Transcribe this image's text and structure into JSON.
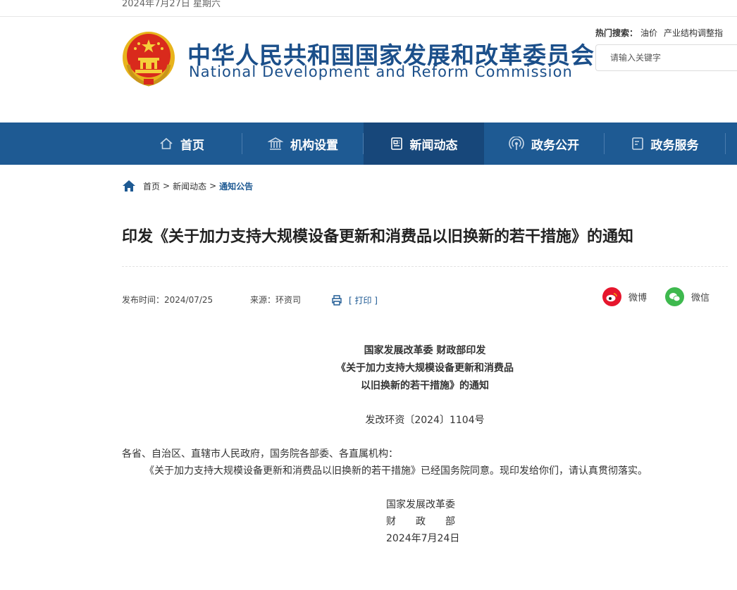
{
  "topbar": {
    "date": "2024年7月27日 星期六"
  },
  "header": {
    "title_cn": "中华人民共和国国家发展和改革委员会",
    "title_en": "National Development and Reform Commission",
    "hot_search_label": "热门搜索：",
    "hot_keywords": [
      "油价",
      "产业结构调整指"
    ],
    "search_placeholder": "请输入关键字"
  },
  "nav": {
    "items": [
      {
        "label": "首页",
        "icon": "home-icon"
      },
      {
        "label": "机构设置",
        "icon": "institution-icon"
      },
      {
        "label": "新闻动态",
        "icon": "news-icon",
        "active": true
      },
      {
        "label": "政务公开",
        "icon": "broadcast-icon"
      },
      {
        "label": "政务服务",
        "icon": "service-icon"
      }
    ],
    "colors": {
      "bar": "#1e5a93",
      "active": "#17477a"
    }
  },
  "breadcrumb": {
    "home": "首页",
    "level1": "新闻动态",
    "current": "通知公告",
    "separator": ">"
  },
  "article": {
    "title": "印发《关于加力支持大规模设备更新和消费品以旧换新的若干措施》的通知",
    "publish_time": "发布时间：2024/07/25",
    "source": "来源：环资司",
    "print_label": "[ 打印 ]",
    "share": {
      "weibo": "微博",
      "wechat": "微信"
    },
    "doc_heading": [
      "国家发展改革委 财政部印发",
      "《关于加力支持大规模设备更新和消费品",
      "以旧换新的若干措施》的通知"
    ],
    "doc_number": "发改环资〔2024〕1104号",
    "recipients": "各省、自治区、直辖市人民政府，国务院各部委、各直属机构：",
    "body": "《关于加力支持大规模设备更新和消费品以旧换新的若干措施》已经国务院同意。现印发给你们，请认真贯彻落实。",
    "signature": [
      "国家发展改革委",
      "财　　政　　部",
      "2024年7月24日"
    ]
  }
}
